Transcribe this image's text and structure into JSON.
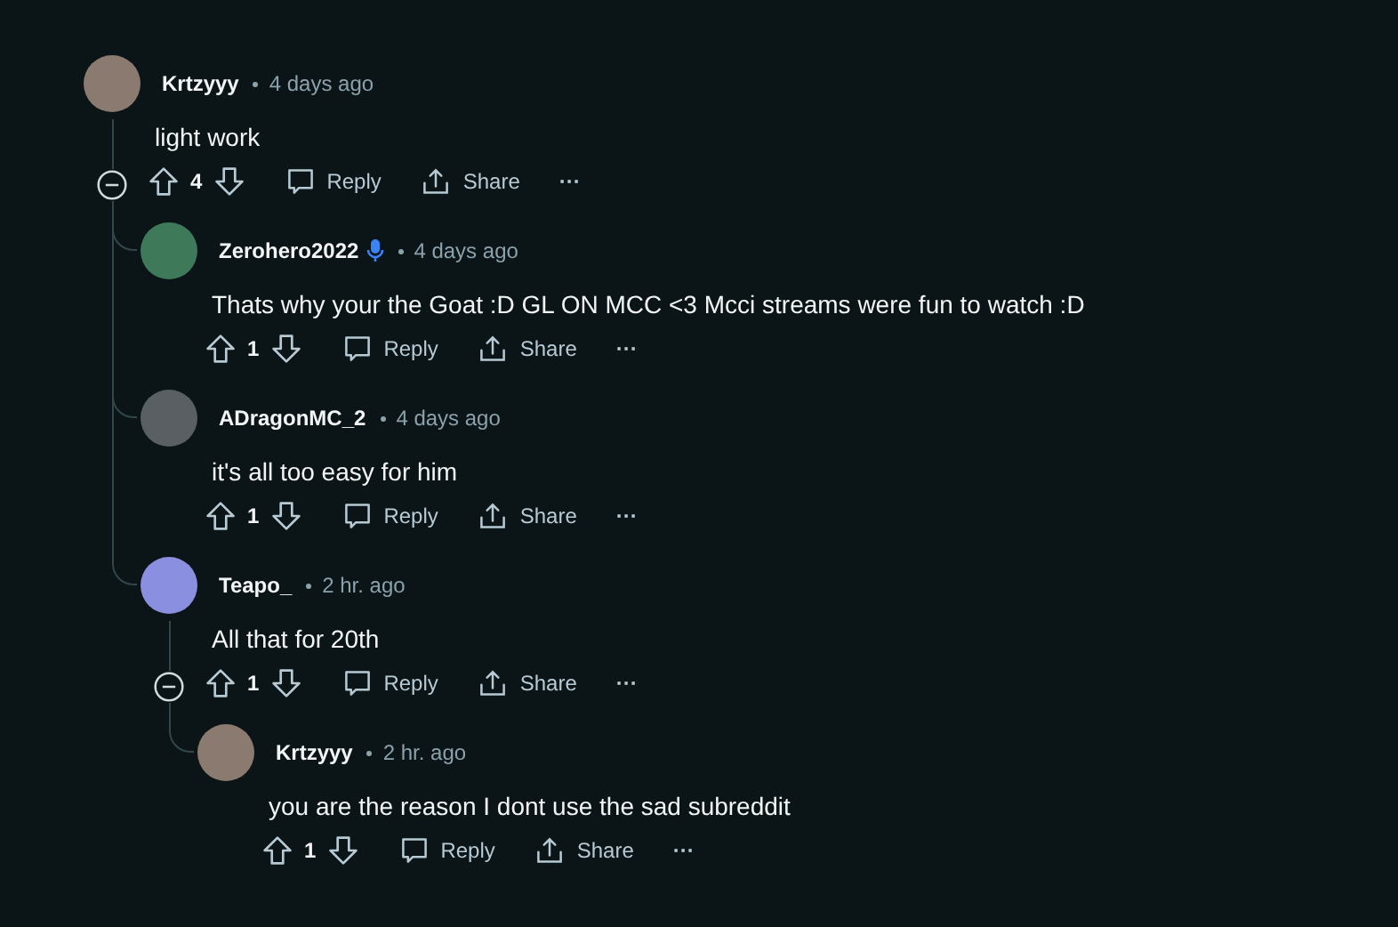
{
  "comments": [
    {
      "author": "Krtzyyy",
      "mic": false,
      "time": "4 days ago",
      "body": "light work",
      "score": "4",
      "actions": {
        "reply": "Reply",
        "share": "Share",
        "more": "···"
      },
      "children": [
        {
          "author": "Zerohero2022",
          "mic": true,
          "time": "4 days ago",
          "body": "Thats why your the Goat :D GL ON MCC <3 Mcci streams were fun to watch :D",
          "score": "1",
          "actions": {
            "reply": "Reply",
            "share": "Share",
            "more": "···"
          }
        },
        {
          "author": "ADragonMC_2",
          "mic": false,
          "time": "4 days ago",
          "body": "it's all too easy for him",
          "score": "1",
          "actions": {
            "reply": "Reply",
            "share": "Share",
            "more": "···"
          }
        },
        {
          "author": "Teapo_",
          "mic": false,
          "time": "2 hr. ago",
          "body": "All that for 20th",
          "score": "1",
          "actions": {
            "reply": "Reply",
            "share": "Share",
            "more": "···"
          },
          "children": [
            {
              "author": "Krtzyyy",
              "mic": false,
              "time": "2 hr. ago",
              "body": "you are the reason I dont use the sad subreddit",
              "score": "1",
              "actions": {
                "reply": "Reply",
                "share": "Share",
                "more": "···"
              }
            }
          ]
        }
      ]
    }
  ]
}
